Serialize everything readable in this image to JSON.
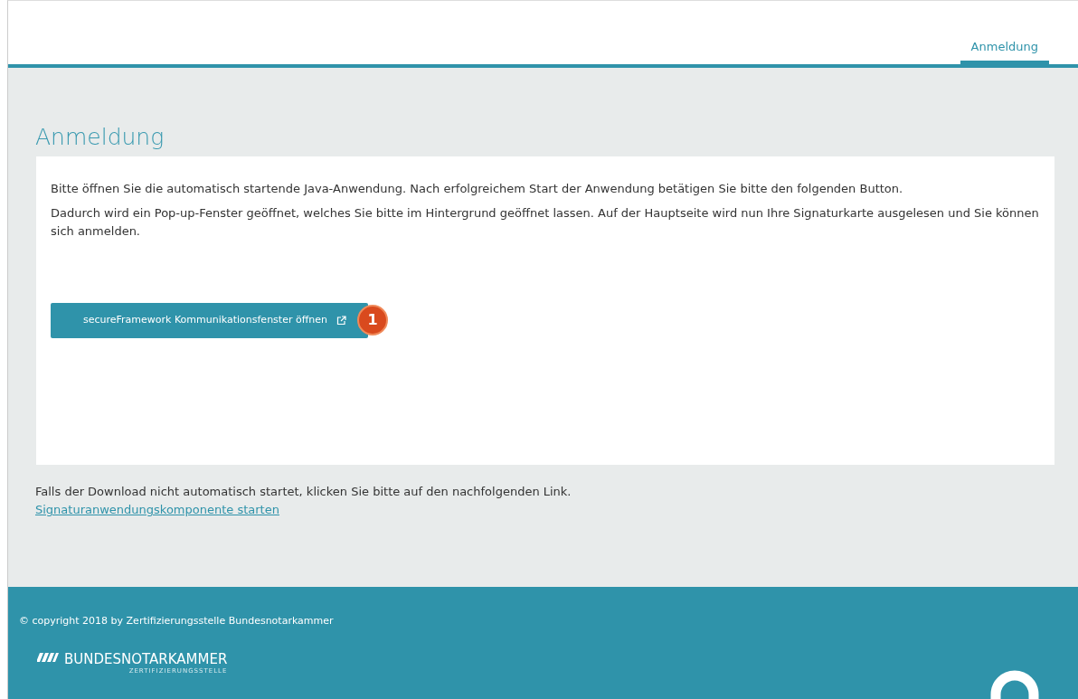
{
  "nav": {
    "tabs": [
      {
        "label": "Anmeldung",
        "selected": true
      }
    ]
  },
  "page_title": "Anmeldung",
  "card": {
    "paragraphs": [
      "Bitte öffnen Sie die automatisch startende Java-Anwendung. Nach erfolgreichem Start der Anwendung betätigen Sie bitte den folgenden Button.",
      "Dadurch wird ein Pop-up-Fenster geöffnet, welches Sie bitte im Hintergrund geöffnet lassen. Auf der Hauptseite wird nun Ihre Signaturkarte ausgelesen und Sie können sich anmelden."
    ],
    "button": {
      "label": "secureFramework Kommunikationsfenster öffnen",
      "callout": "1"
    }
  },
  "download_note": "Falls der Download nicht automatisch startet, klicken Sie bitte auf den nachfolgenden Link.",
  "download_link": "Signaturanwendungskomponente starten",
  "footer": {
    "copyright": "© copyright 2018 by Zertifizierungsstelle Bundesnotarkammer",
    "logo_name": "BUNDESNOTARKAMMER",
    "logo_sub": "ZERTIFIZIERUNGSSTELLE"
  }
}
